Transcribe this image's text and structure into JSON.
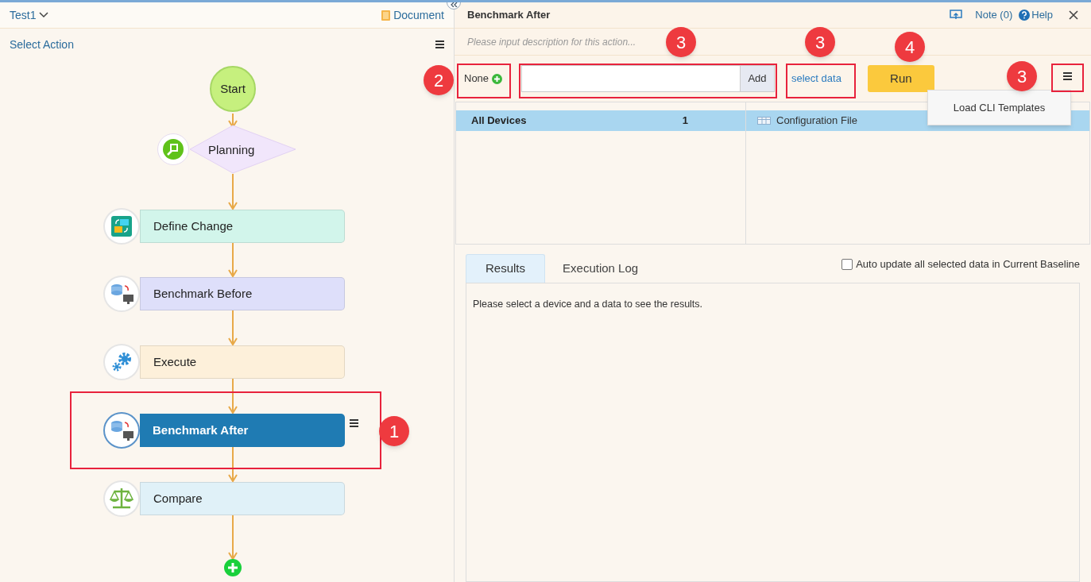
{
  "left_panel": {
    "project": "Test1",
    "document_link": "Document",
    "select_action": "Select Action"
  },
  "flow": {
    "start": "Start",
    "nodes": [
      {
        "kind": "decision",
        "label": "Planning",
        "color": "#f1e6fb",
        "selected": false
      },
      {
        "kind": "change",
        "label": "Define Change",
        "color": "#d2f5eb",
        "selected": false
      },
      {
        "kind": "benchmark",
        "label": "Benchmark Before",
        "color": "#dedffa",
        "selected": false
      },
      {
        "kind": "gears",
        "label": "Execute",
        "color": "#fdf0da",
        "selected": false
      },
      {
        "kind": "benchmark",
        "label": "Benchmark After",
        "color": "#1f7bb3",
        "selected": true
      },
      {
        "kind": "scale",
        "label": "Compare",
        "color": "#e0f1f8",
        "selected": false
      }
    ]
  },
  "action_panel": {
    "title": "Benchmark After",
    "note": "Note (0)",
    "help": "Help",
    "description_placeholder": "Please input description for this action...",
    "device_selector": "None",
    "add_button": "Add",
    "select_data": "select data",
    "run_button": "Run",
    "menu_items": [
      "Load CLI Templates"
    ]
  },
  "devices": [
    {
      "name": "All Devices",
      "count": "1",
      "selected": true
    }
  ],
  "data_items": [
    {
      "name": "Configuration File",
      "selected": true
    }
  ],
  "result_tabs": [
    {
      "label": "Results",
      "selected": true
    },
    {
      "label": "Execution Log",
      "selected": false
    }
  ],
  "auto_update": {
    "label": "Auto update all selected data in Current Baseline",
    "checked": false
  },
  "results_message": "Please select a device and a data to see the results.",
  "callouts": [
    {
      "number": "1"
    },
    {
      "number": "2"
    },
    {
      "number": "3"
    },
    {
      "number": "3"
    },
    {
      "number": "4"
    },
    {
      "number": "3"
    }
  ]
}
